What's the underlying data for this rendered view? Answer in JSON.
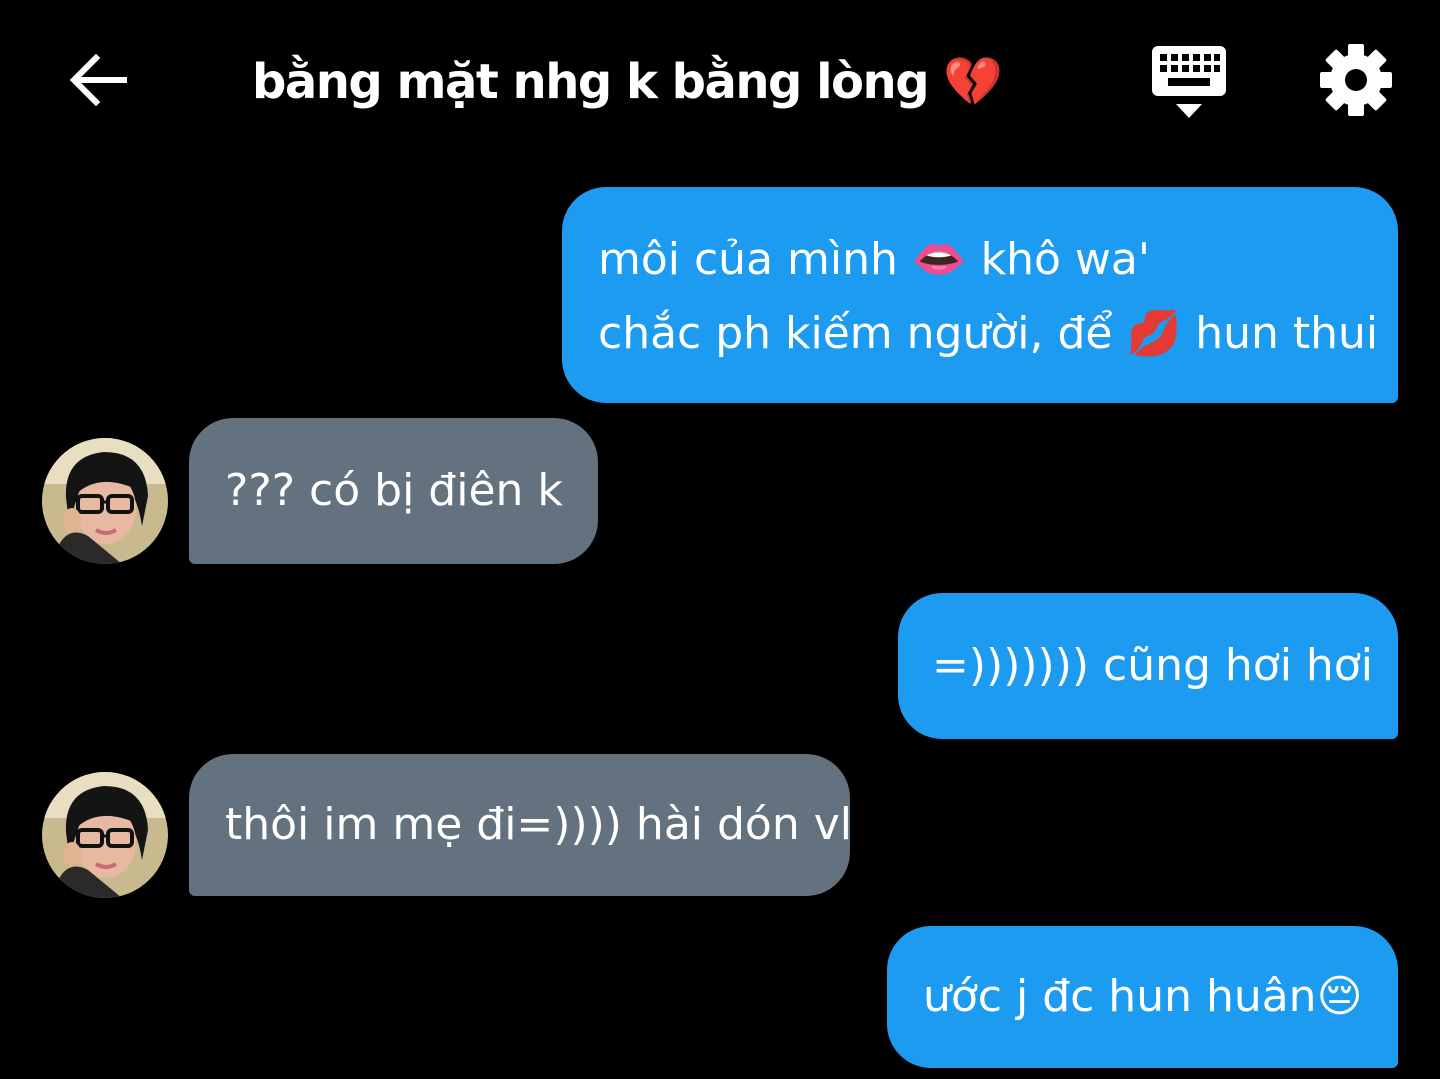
{
  "header": {
    "title": "bằng mặt nhg k bằng lòng 💔",
    "back_icon": "arrow-left-icon",
    "keyboard_icon": "keyboard-icon",
    "settings_icon": "gear-icon"
  },
  "colors": {
    "background": "#000000",
    "outgoing_bubble": "#1d9bf0",
    "incoming_bubble": "#64717e",
    "text": "#ffffff"
  },
  "messages": [
    {
      "direction": "outgoing",
      "lines": [
        "môi của mình 👄 khô wa'",
        "chắc ph kiếm người, để 💋 hun thui"
      ]
    },
    {
      "direction": "incoming",
      "lines": [
        "??? có bị điên k"
      ]
    },
    {
      "direction": "outgoing",
      "lines": [
        "=))))))) cũng hơi hơi"
      ]
    },
    {
      "direction": "incoming",
      "lines": [
        "thôi im mẹ đi=)))) hài dón vl"
      ]
    },
    {
      "direction": "outgoing",
      "lines": [
        "ước j đc hun huân😔"
      ]
    }
  ]
}
